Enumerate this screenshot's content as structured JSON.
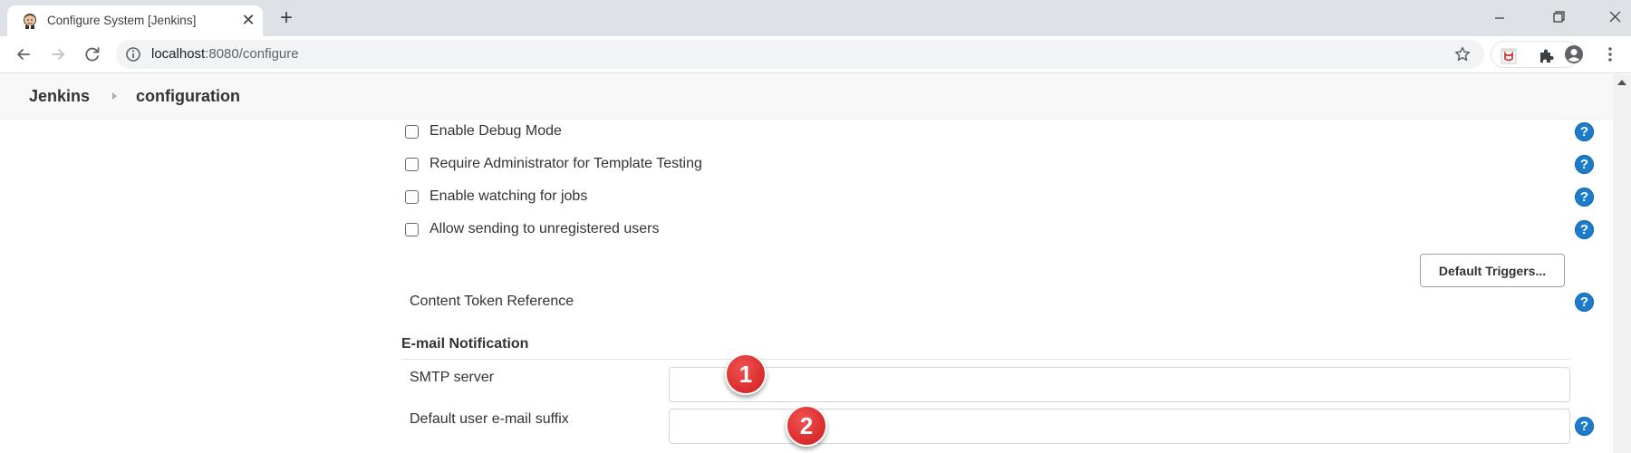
{
  "browser": {
    "tab": {
      "title": "Configure System [Jenkins]",
      "favicon": "jenkins-butler-icon",
      "close_glyph": "✕"
    },
    "new_tab_glyph": "+",
    "window_controls": [
      "minimize",
      "restore",
      "close"
    ],
    "url": {
      "host": "localhost",
      "path": ":8080/configure"
    },
    "toolbar_icons": [
      "back-arrow-icon",
      "forward-arrow-icon",
      "reload-icon",
      "info-icon",
      "star-icon",
      "extension-icon",
      "puzzle-icon",
      "profile-icon",
      "kebab-menu-icon"
    ]
  },
  "breadcrumb": {
    "root": "Jenkins",
    "current": "configuration"
  },
  "options": [
    {
      "label": "Enable Debug Mode",
      "checked": false
    },
    {
      "label": "Require Administrator for Template Testing",
      "checked": false
    },
    {
      "label": "Enable watching for jobs",
      "checked": false
    },
    {
      "label": "Allow sending to unregistered users",
      "checked": false
    }
  ],
  "default_triggers_label": "Default Triggers...",
  "content_token_label": "Content Token Reference",
  "help_glyph": "?",
  "email_section": {
    "title": "E-mail Notification",
    "fields": [
      {
        "label": "SMTP server",
        "value": "",
        "callout": "1"
      },
      {
        "label": "Default user e-mail suffix",
        "value": "",
        "callout": "2"
      }
    ]
  },
  "colors": {
    "help_blue": "#1c7ccb",
    "callout_red": "#d92b2b",
    "tabstrip": "#dee1e6",
    "breadcrumb_bg": "#f8f8f8"
  }
}
